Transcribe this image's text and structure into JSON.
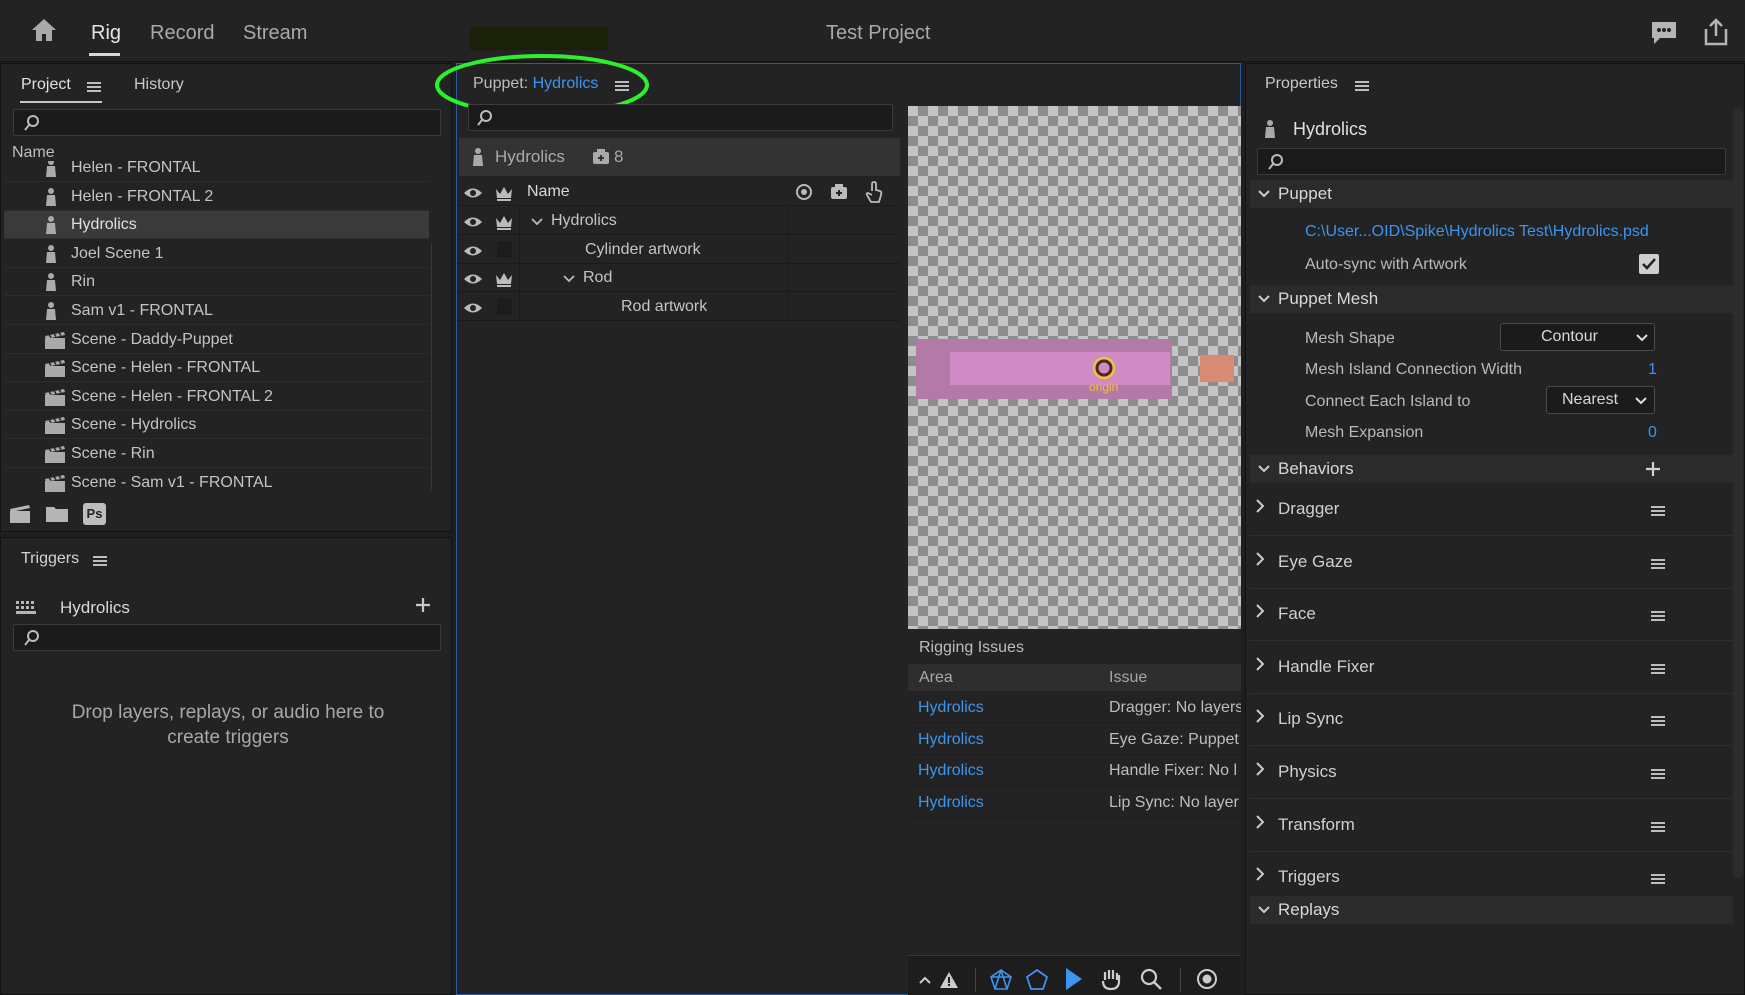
{
  "topbar": {
    "tabs": [
      "Rig",
      "Record",
      "Stream"
    ],
    "active_tab": "Rig",
    "title": "Test Project"
  },
  "project": {
    "tabs": [
      "Project",
      "History"
    ],
    "column_name": "Name",
    "items": [
      {
        "label": "Helen - FRONTAL",
        "type": "puppet"
      },
      {
        "label": "Helen - FRONTAL 2",
        "type": "puppet"
      },
      {
        "label": "Hydrolics",
        "type": "puppet",
        "selected": true
      },
      {
        "label": "Joel Scene 1",
        "type": "puppet"
      },
      {
        "label": "Rin",
        "type": "puppet"
      },
      {
        "label": "Sam v1 - FRONTAL",
        "type": "puppet"
      },
      {
        "label": "Scene - Daddy-Puppet",
        "type": "scene"
      },
      {
        "label": "Scene - Helen - FRONTAL",
        "type": "scene"
      },
      {
        "label": "Scene - Helen - FRONTAL 2",
        "type": "scene"
      },
      {
        "label": "Scene - Hydrolics",
        "type": "scene"
      },
      {
        "label": "Scene - Rin",
        "type": "scene"
      },
      {
        "label": "Scene - Sam v1 - FRONTAL",
        "type": "scene"
      }
    ],
    "footer_ps": "Ps"
  },
  "triggers": {
    "title": "Triggers",
    "puppet": "Hydrolics",
    "empty_text": "Drop layers, replays, or audio here to create triggers"
  },
  "puppet_panel": {
    "prefix": "Puppet:",
    "name": "Hydrolics",
    "header_name": "Hydrolics",
    "count": "8",
    "column_name": "Name",
    "layers": [
      {
        "label": "Hydrolics",
        "expander": true,
        "crown": true
      },
      {
        "label": "Cylinder artwork",
        "expander": false,
        "crown": false
      },
      {
        "label": "Rod",
        "expander": true,
        "crown": true
      },
      {
        "label": "Rod artwork",
        "expander": false,
        "crown": false
      }
    ]
  },
  "canvas": {
    "origin_label": "origin"
  },
  "rigging_issues": {
    "title": "Rigging Issues",
    "columns": [
      "Area",
      "Issue"
    ],
    "rows": [
      {
        "area": "Hydrolics",
        "issue": "Dragger: No layers"
      },
      {
        "area": "Hydrolics",
        "issue": "Eye Gaze: Puppet"
      },
      {
        "area": "Hydrolics",
        "issue": "Handle Fixer: No l"
      },
      {
        "area": "Hydrolics",
        "issue": "Lip Sync: No layer"
      }
    ]
  },
  "properties": {
    "title": "Properties",
    "puppet": "Hydrolics",
    "section_puppet": "Puppet",
    "path": "C:\\User...OID\\Spike\\Hydrolics Test\\Hydrolics.psd",
    "auto_sync_label": "Auto-sync with Artwork",
    "auto_sync_checked": true,
    "section_mesh": "Puppet Mesh",
    "mesh_shape_label": "Mesh Shape",
    "mesh_shape_value": "Contour",
    "island_width_label": "Mesh Island Connection Width",
    "island_width_value": "1",
    "connect_label": "Connect Each Island to",
    "connect_value": "Nearest",
    "expansion_label": "Mesh Expansion",
    "expansion_value": "0",
    "section_behaviors": "Behaviors",
    "behaviors": [
      "Dragger",
      "Eye Gaze",
      "Face",
      "Handle Fixer",
      "Lip Sync",
      "Physics",
      "Transform",
      "Triggers"
    ],
    "section_replays": "Replays"
  },
  "colors": {
    "accent_blue": "#3c95f0",
    "highlight_green": "#2cf02c",
    "mesh_pink": "#c77ab8",
    "tail_orange": "#d98a72"
  }
}
